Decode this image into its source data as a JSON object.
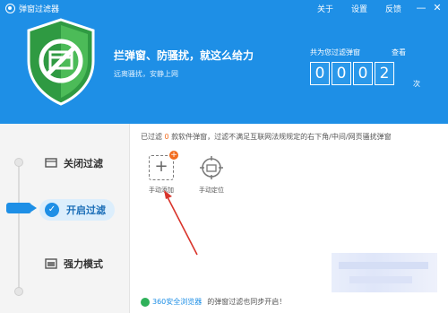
{
  "titlebar": {
    "app_title": "弹窗过滤器",
    "links": [
      "关于",
      "设置",
      "反馈"
    ],
    "minimize": "—",
    "close": "✕"
  },
  "banner": {
    "slogan": "拦弹窗、防骚扰，就这么给力",
    "subslogan": "远离骚扰，安静上网",
    "count_label": "共为您过滤弹窗",
    "view_label": "查看",
    "digits": [
      "0",
      "0",
      "0",
      "2"
    ],
    "unit": "次"
  },
  "modes": {
    "off": "关闭过滤",
    "on": "开启过滤",
    "strong": "强力模式"
  },
  "info": {
    "prefix": "已过滤",
    "count": "0",
    "suffix": "款软件弹窗，过滤不满足互联网法规规定的右下角/中间/网页骚扰弹窗"
  },
  "tools": {
    "add_label": "手动添加",
    "add_symbol": "+",
    "badge_symbol": "+",
    "locate_label": "手动定位"
  },
  "footer": {
    "link": "360安全浏览器",
    "text": "的弹窗过滤也同步开启！"
  },
  "colors": {
    "brand": "#1e8fe6",
    "accent": "#f26b1d",
    "shield": "#3aa64a"
  }
}
